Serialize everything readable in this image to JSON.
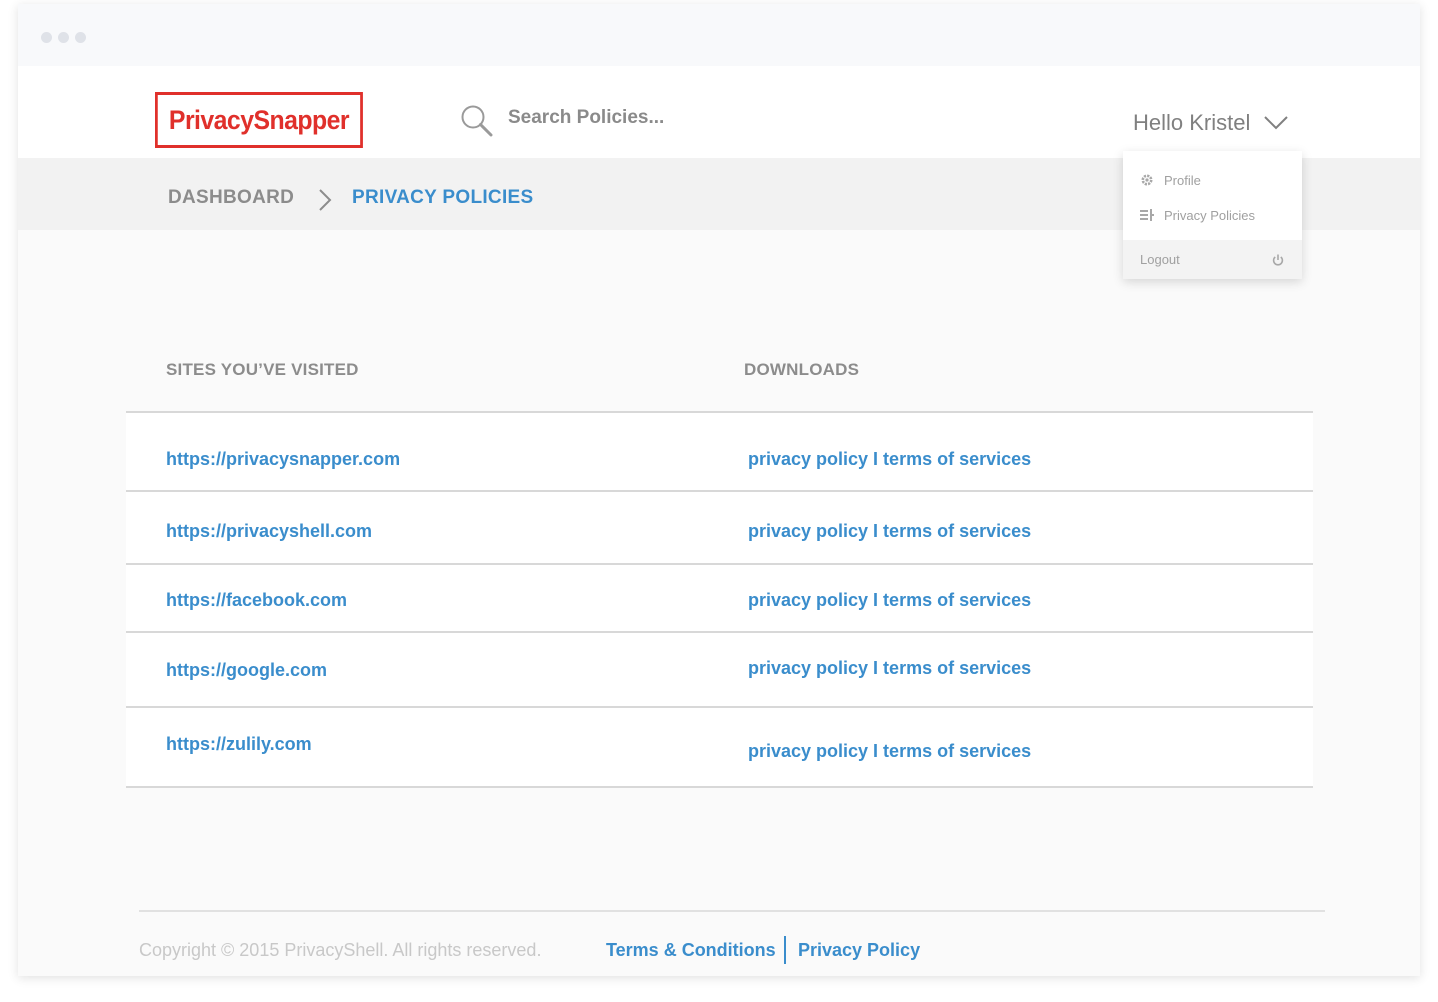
{
  "app": {
    "logo_text": "PrivacySnapper"
  },
  "search": {
    "placeholder": "Search Policies..."
  },
  "user": {
    "greeting": "Hello Kristel"
  },
  "breadcrumb": {
    "items": [
      "DASHBOARD",
      "PRIVACY POLICIES"
    ]
  },
  "dropdown": {
    "items": [
      {
        "label": "Profile",
        "icon": "gear-icon"
      },
      {
        "label": "Privacy Policies",
        "icon": "list-icon"
      }
    ],
    "logout": {
      "label": "Logout",
      "icon": "power-icon"
    }
  },
  "table": {
    "headers": [
      "SITES YOU’VE VISITED",
      "DOWNLOADS"
    ],
    "rows": [
      {
        "site": "https://privacysnapper.com",
        "downloads": "privacy policy I terms of services"
      },
      {
        "site": "https://privacyshell.com",
        "downloads": "privacy policy I terms of services"
      },
      {
        "site": "https://facebook.com",
        "downloads": "privacy policy I terms of services"
      },
      {
        "site": "https://google.com",
        "downloads": "privacy policy I terms of services"
      },
      {
        "site": "https://zulily.com",
        "downloads": "privacy policy I terms of services"
      }
    ]
  },
  "footer": {
    "copyright": "Copyright © 2015 PrivacyShell. All rights reserved.",
    "links": [
      "Terms & Conditions",
      "Privacy Policy"
    ]
  },
  "colors": {
    "brand_red": "#e0302b",
    "link_blue": "#3a8dcc",
    "muted_gray": "#8c8c8c"
  }
}
